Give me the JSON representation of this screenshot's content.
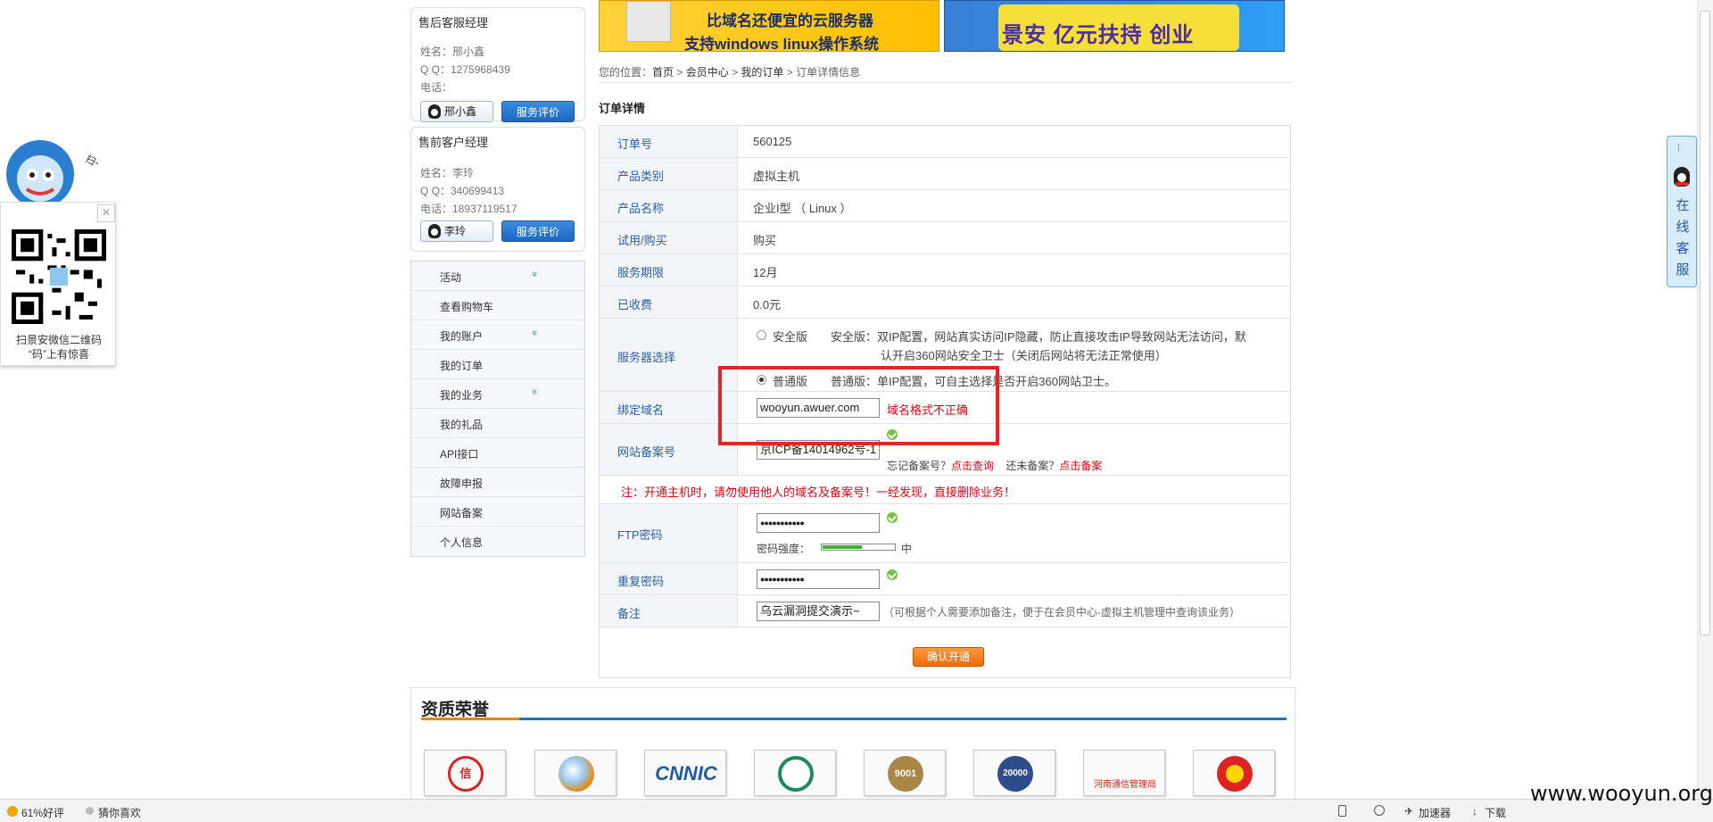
{
  "left_widget": {
    "close": "×",
    "qr_text_1": "扫景安微信二维码",
    "qr_text_2": "“码”上有惊喜",
    "mascot_text": "扫一扫"
  },
  "right_tab": {
    "text": "在线客服"
  },
  "banners": {
    "b1_line1": "比域名还便宜的云服务器",
    "b1_line2": "支持windows linux操作系统",
    "b2_text": "景安 亿元扶持 创业"
  },
  "after_sales": {
    "title": "售后客服经理",
    "name": "姓名：邢小鑫",
    "qq": "Q Q：1275968439",
    "phone": "电话：",
    "qq_btn": "邢小鑫",
    "rate_btn": "服务评价"
  },
  "pre_sales": {
    "title": "售前客户经理",
    "name": "姓名：李玲",
    "qq": "Q Q：340699413",
    "phone": "电话：18937119517",
    "qq_btn": "李玲",
    "rate_btn": "服务评价"
  },
  "menu": [
    {
      "label": "活动",
      "chev": "»"
    },
    {
      "label": "查看购物车",
      "chev": ""
    },
    {
      "label": "我的账户",
      "chev": "»"
    },
    {
      "label": "我的订单",
      "chev": ""
    },
    {
      "label": "我的业务",
      "chev": "»"
    },
    {
      "label": "我的礼品",
      "chev": ""
    },
    {
      "label": "API接口",
      "chev": ""
    },
    {
      "label": "故障申报",
      "chev": ""
    },
    {
      "label": "网站备案",
      "chev": ""
    },
    {
      "label": "个人信息",
      "chev": ""
    }
  ],
  "breadcrumb": {
    "prefix": "您的位置：",
    "home": "首页",
    "sep": " > ",
    "member": "会员中心",
    "orders": "我的订单",
    "current": "订单详情信息"
  },
  "order": {
    "title": "订单详情",
    "order_no_label": "订单号",
    "order_no": "560125",
    "category_label": "产品类别",
    "category": "虚拟主机",
    "name_label": "产品名称",
    "name": "企业I型 （ Linux ）",
    "trial_label": "试用/购买",
    "trial": "购买",
    "period_label": "服务期限",
    "period": "12月",
    "fee_label": "已收费",
    "fee": "0.0元",
    "server_label": "服务器选择",
    "opt_secure": "安全版",
    "opt_secure_desc1": "安全版：双IP配置，网站真实访问IP隐藏，防止直接攻击IP导致网站无法访问，默",
    "opt_secure_desc2": "认开启360网站安全卫士（关闭后网站将无法正常使用）",
    "opt_normal": "普通版",
    "opt_normal_desc": "普通版：单IP配置，可自主选择是否开启360网站卫士。",
    "domain_label": "绑定域名",
    "domain_value": "wooyun.awuer.com",
    "domain_error": "域名格式不正确",
    "icp_label": "网站备案号",
    "icp_value": "京ICP备14014962号-1",
    "icp_forgot": "忘记备案号？",
    "icp_query": "点击查询",
    "icp_none": "还未备案？",
    "icp_apply": "点击备案",
    "warning": "注：开通主机时，请勿使用他人的域名及备案号！一经发现，直接删除业务！",
    "ftp_label": "FTP密码",
    "ftp_value": "●●●●●●●●●●●",
    "strength_label": "密码强度：",
    "strength_value": "中",
    "strength_fraction": 0.55,
    "repeat_label": "重复密码",
    "repeat_value": "●●●●●●●●●●●",
    "note_label": "备注",
    "note_value": "乌云漏洞提交演示~",
    "note_hint": "（可根据个人需要添加备注，便于在会员中心-虚拟主机管理中查询该业务）",
    "confirm": "确认开通"
  },
  "honors": {
    "title": "资质荣誉",
    "badges": [
      "信",
      "",
      "CNNIC",
      "",
      "9001",
      "20000",
      "河南通信管理局",
      ""
    ]
  },
  "statusbar": {
    "rating": "61%好评",
    "guess": "猜你喜欢",
    "accel": "加速器",
    "download": "下载"
  },
  "watermark": "www.wooyun.org",
  "colors": {
    "accent_blue": "#1e73be",
    "orange": "#f08300",
    "error_red": "#e60012",
    "label_bg": "#f2f6fb"
  }
}
